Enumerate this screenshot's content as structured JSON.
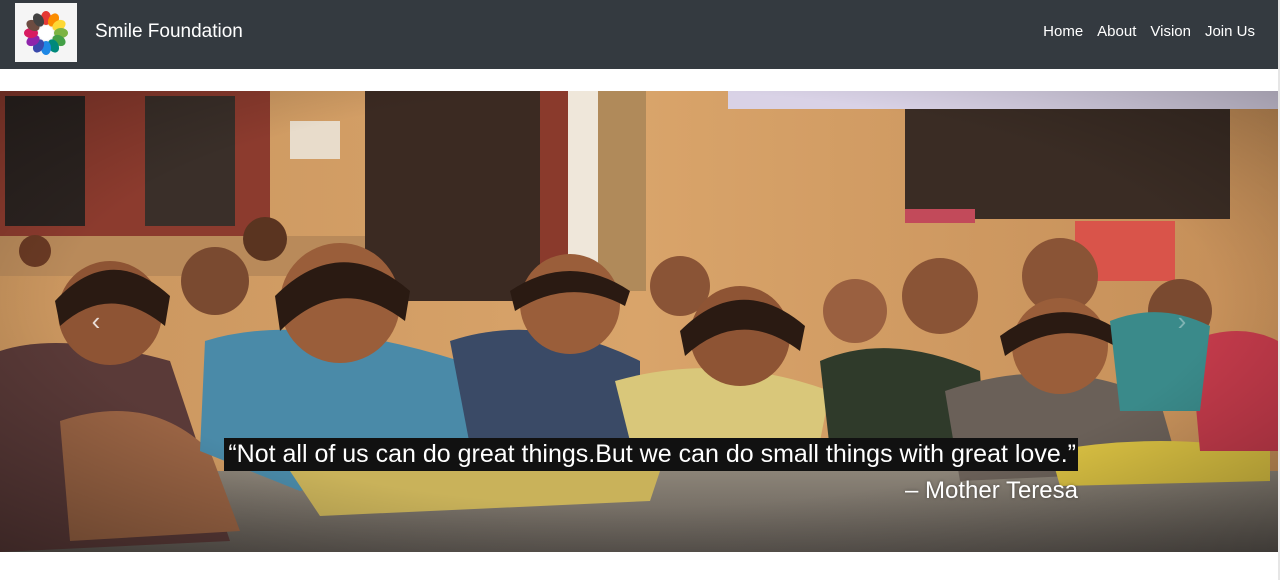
{
  "navbar": {
    "brand": "Smile Foundation",
    "links": [
      "Home",
      "About",
      "Vision",
      "Join Us"
    ]
  },
  "carousel": {
    "prev_icon": "chevron-left-icon",
    "next_icon": "chevron-right-icon",
    "quote": "“Not all of us can do great things.But we can do small things with great love.”",
    "author": "– Mother Teresa"
  },
  "colors": {
    "navbar_bg": "#343a40",
    "text": "#ffffff",
    "caption_bg": "#111111"
  }
}
